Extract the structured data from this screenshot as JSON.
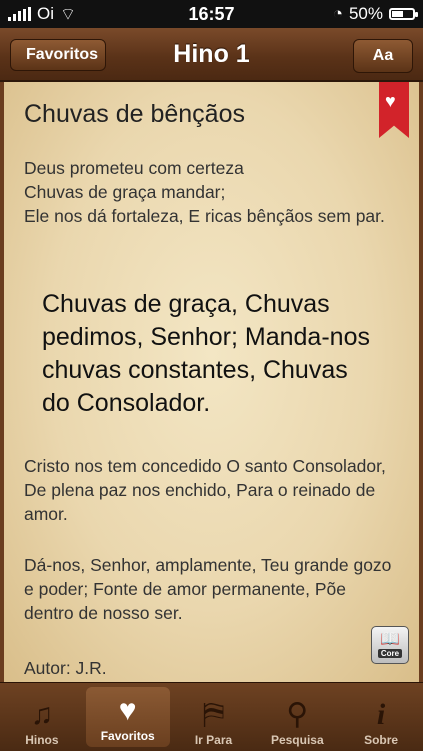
{
  "status": {
    "carrier": "Oi",
    "time": "16:57",
    "battery": "50%",
    "battery_level": 0.5
  },
  "nav": {
    "back_label": "Favoritos",
    "title": "Hino 1",
    "font_button": "Aa"
  },
  "hymn": {
    "title": "Chuvas de bênçãos",
    "verse1": "Deus prometeu com certeza\nChuvas de graça mandar;\nEle nos dá fortaleza, E ricas bênçãos sem par.",
    "chorus": "Chuvas de graça, Chuvas pedimos, Senhor; Manda-nos chuvas constantes, Chuvas do Consolador.",
    "verse2": "Cristo nos tem concedido O santo Consolador, De plena paz nos enchido, Para o reinado de amor.",
    "verse3": "Dá-nos, Senhor, amplamente, Teu grande gozo e poder; Fonte de amor permanente, Põe dentro de nosso ser.",
    "author": "Autor: J.R.",
    "core_label": "Core"
  },
  "tabs": [
    {
      "label": "Hinos",
      "icon": "music-note-icon"
    },
    {
      "label": "Favoritos",
      "icon": "heart-icon"
    },
    {
      "label": "Ir Para",
      "icon": "signpost-icon"
    },
    {
      "label": "Pesquisa",
      "icon": "search-icon"
    },
    {
      "label": "Sobre",
      "icon": "info-icon"
    }
  ],
  "colors": {
    "bookmark": "#d2232a",
    "leather": "#5a3218",
    "paper": "#ead7ae"
  }
}
